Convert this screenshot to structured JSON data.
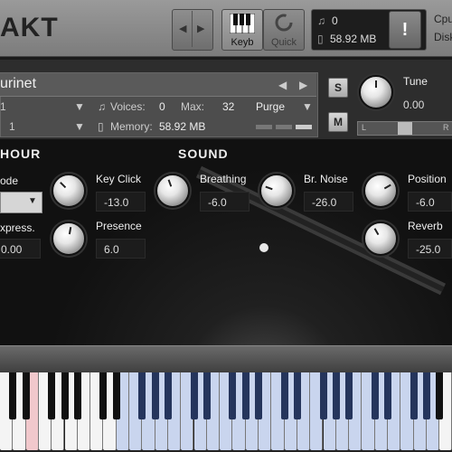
{
  "topbar": {
    "brand": "AKT",
    "prev_icon": "chevron-left",
    "next_icon": "chevron-right",
    "keyb_label": "Keyb",
    "quick_label": "Quick",
    "voices_count": "0",
    "memory": "58.92 MB",
    "alert": "!",
    "cpu_label": "Cpu",
    "disk_label": "Disk"
  },
  "instrument": {
    "name": "urinet",
    "midi_channel": "1",
    "output": "1",
    "voices_label": "Voices:",
    "voices_value": "0",
    "max_label": "Max:",
    "max_value": "32",
    "purge_label": "Purge",
    "memory_label": "Memory:",
    "memory_value": "58.92 MB",
    "solo": "S",
    "mute": "M",
    "tune_label": "Tune",
    "tune_value": "0.00",
    "pan_left": "L",
    "pan_right": "R"
  },
  "sections": {
    "left_title": "HOUR",
    "sound_title": "SOUND"
  },
  "controls": {
    "mode_label": "ode",
    "express_label": "xpress.",
    "express_value": "0.00",
    "key_click_label": "Key Click",
    "key_click_value": "-13.0",
    "presence_label": "Presence",
    "presence_value": "6.0",
    "breathing_label": "Breathing",
    "breathing_value": "-6.0",
    "br_noise_label": "Br. Noise",
    "br_noise_value": "-26.0",
    "position_label": "Position",
    "position_value": "-6.0",
    "reverb_label": "Reverb",
    "reverb_value": "-25.0"
  },
  "colors": {
    "keyrange_blue": "#c9d5ee",
    "keyswitch_pink": "#f1c8cc"
  }
}
